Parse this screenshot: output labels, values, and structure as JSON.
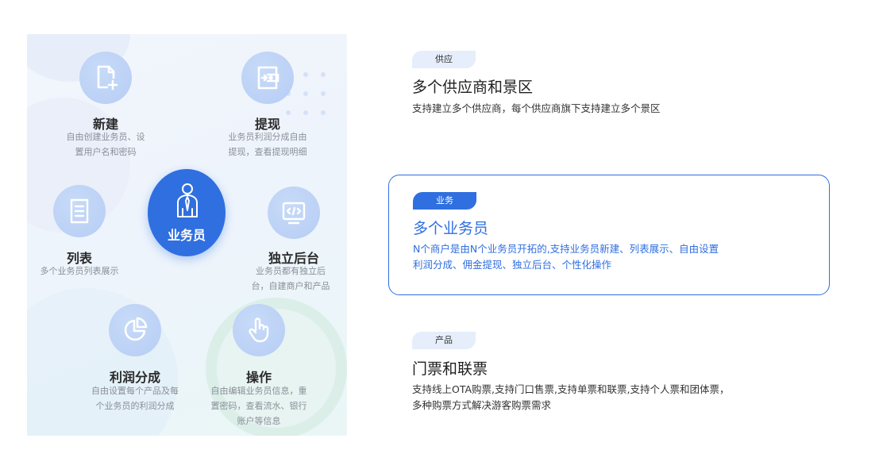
{
  "illustration": {
    "center_label": "业务员",
    "features": [
      {
        "title": "新建",
        "desc_lines": [
          "自由创建业务员、设",
          "置用户名和密码"
        ]
      },
      {
        "title": "提现",
        "desc_lines": [
          "业务员利润分成自由",
          "提现，查看提现明细"
        ]
      },
      {
        "title": "列表",
        "desc_lines": [
          "多个业务员列表展示"
        ]
      },
      {
        "title": "独立后台",
        "desc_lines": [
          "业务员都有独立后",
          "台，自建商户和产品"
        ]
      },
      {
        "title": "利润分成",
        "desc_lines": [
          "自由设置每个产品及每",
          "个业务员的利润分成"
        ]
      },
      {
        "title": "操作",
        "desc_lines": [
          "自由编辑业务员信息，重",
          "置密码，查看流水、银行",
          "账户等信息"
        ]
      }
    ]
  },
  "sections": [
    {
      "tag": "供应",
      "title": "多个供应商和景区",
      "desc_lines": [
        "支持建立多个供应商，每个供应商旗下支持建立多个景区"
      ]
    },
    {
      "tag": "业务",
      "title": "多个业务员",
      "desc_lines": [
        "N个商户是由N个业务员开拓的,支持业务员新建、列表展示、自由设置",
        "利润分成、佣金提现、独立后台、个性化操作"
      ]
    },
    {
      "tag": "产品",
      "title": "门票和联票",
      "desc_lines": [
        "支持线上OTA购票,支持门口售票,支持单票和联票,支持个人票和团体票，",
        "多种购票方式解决游客购票需求"
      ]
    }
  ],
  "colors": {
    "accent": "#2f6fe0",
    "icon_bg": "#b6cdf4",
    "tag_light": "#e6eefb"
  }
}
